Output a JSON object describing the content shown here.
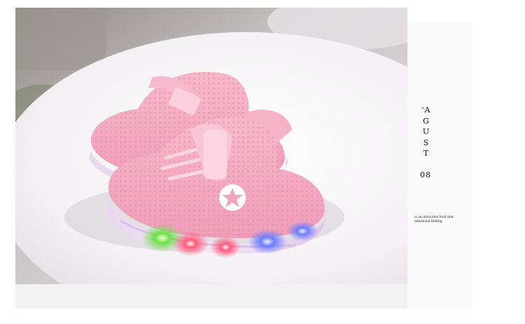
{
  "product": {
    "name_icon": "pink-led-sneaker-image",
    "accent_color": "#f3a9c0"
  },
  "side_panel": {
    "month_letters": [
      "'A",
      "G",
      "U",
      "S",
      "T"
    ],
    "number": "08",
    "caption_lines": [
      "is an attractive look that",
      "emotional feeling"
    ]
  }
}
